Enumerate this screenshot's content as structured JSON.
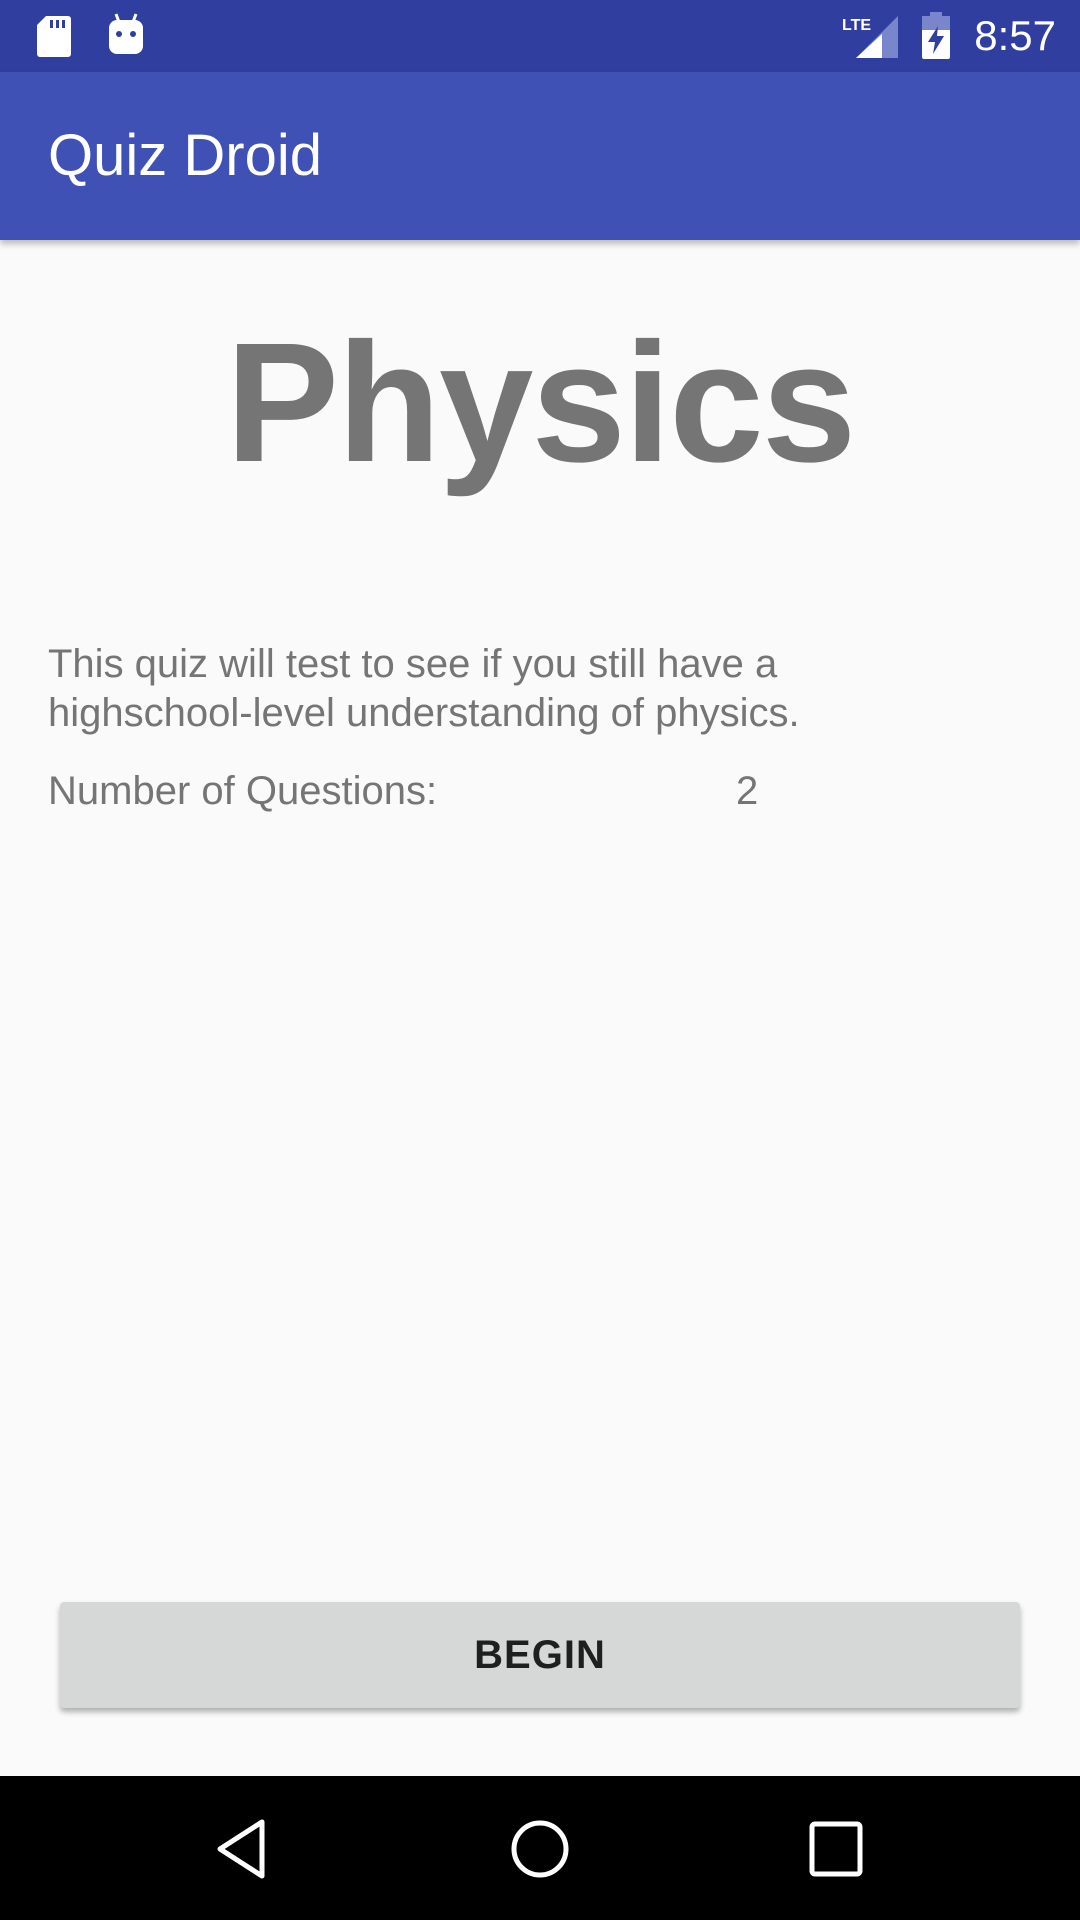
{
  "status_bar": {
    "time": "8:57",
    "network_label": "LTE",
    "icons": [
      "sd-card-icon",
      "android-debug-icon",
      "lte-signal-icon",
      "battery-charging-icon"
    ]
  },
  "app_bar": {
    "title": "Quiz Droid"
  },
  "quiz": {
    "title": "Physics",
    "description": "This quiz will test to see if you still have a highschool-level understanding of physics.",
    "question_count_label": "Number of Questions:",
    "question_count_value": "2"
  },
  "actions": {
    "begin_label": "BEGIN"
  },
  "nav_bar": {
    "icons": [
      "back-icon",
      "home-icon",
      "recents-icon"
    ]
  },
  "colors": {
    "status_bar": "#303f9f",
    "app_bar": "#3f51b5",
    "background": "#fafafa",
    "text_secondary": "#757575",
    "button": "#d6d7d7"
  }
}
